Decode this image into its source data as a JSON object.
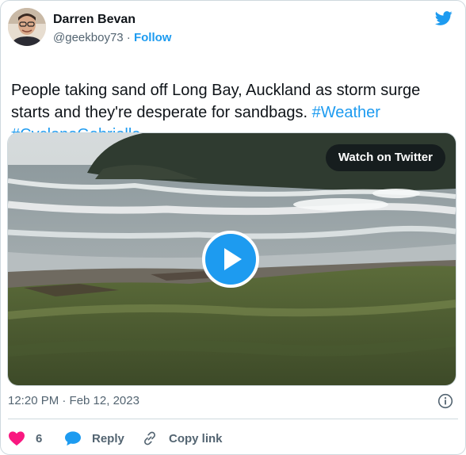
{
  "tweet": {
    "author_name": "Darren Bevan",
    "handle": "@geekboy73",
    "separator": "·",
    "follow_label": "Follow",
    "text_main": "People taking sand off Long Bay, Auckland as storm surge starts and they're desperate for sandbags.",
    "hashtags": [
      "#Weather",
      "#CycloneGabrielle"
    ],
    "media": {
      "watch_label": "Watch on Twitter",
      "play_icon": "play-icon"
    },
    "timestamp": "12:20 PM · Feb 12, 2023",
    "actions": {
      "like_count": "6",
      "reply_label": "Reply",
      "copy_label": "Copy link"
    }
  },
  "colors": {
    "accent": "#1d9bf0",
    "like": "#f91880",
    "text_primary": "#0f1419",
    "text_secondary": "#536471",
    "border": "#cfd9de"
  },
  "icons": [
    "twitter-bird-icon",
    "play-icon",
    "info-icon",
    "heart-icon",
    "reply-bubble-icon",
    "link-icon"
  ]
}
